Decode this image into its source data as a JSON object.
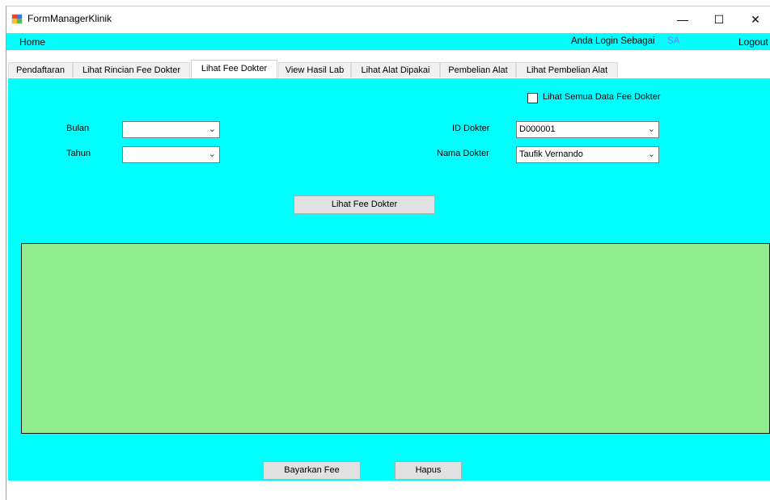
{
  "window": {
    "title": "FormManagerKlinik",
    "minimize_icon": "minimize-icon",
    "maximize_icon": "maximize-icon",
    "close_icon": "close-icon"
  },
  "menubar": {
    "home": "Home",
    "login_label": "Anda Login Sebagai",
    "login_user": "SA",
    "logout": "Logout"
  },
  "tabs": [
    {
      "label": "Pendaftaran"
    },
    {
      "label": "Lihat Rincian Fee Dokter"
    },
    {
      "label": "Lihat Fee Dokter"
    },
    {
      "label": "View Hasil Lab"
    },
    {
      "label": "Lihat Alat Dipakai"
    },
    {
      "label": "Pembelian Alat"
    },
    {
      "label": "Lihat Pembelian Alat"
    }
  ],
  "active_tab": "Lihat Fee Dokter",
  "form": {
    "bulan_label": "Bulan",
    "bulan_value": "",
    "tahun_label": "Tahun",
    "tahun_value": "",
    "id_dokter_label": "ID Dokter",
    "id_dokter_value": "D000001",
    "nama_dokter_label": "Nama Dokter",
    "nama_dokter_value": "Taufik Vernando",
    "lihat_semua_label": "Lihat Semua Data Fee Dokter",
    "lihat_semua_checked": false,
    "lihat_fee_button": "Lihat Fee Dokter",
    "bayarkan_button": "Bayarkan Fee",
    "hapus_button": "Hapus"
  },
  "colors": {
    "background": "#00ffff",
    "grid": "#90ee90",
    "login_user": "#8a70ff"
  }
}
